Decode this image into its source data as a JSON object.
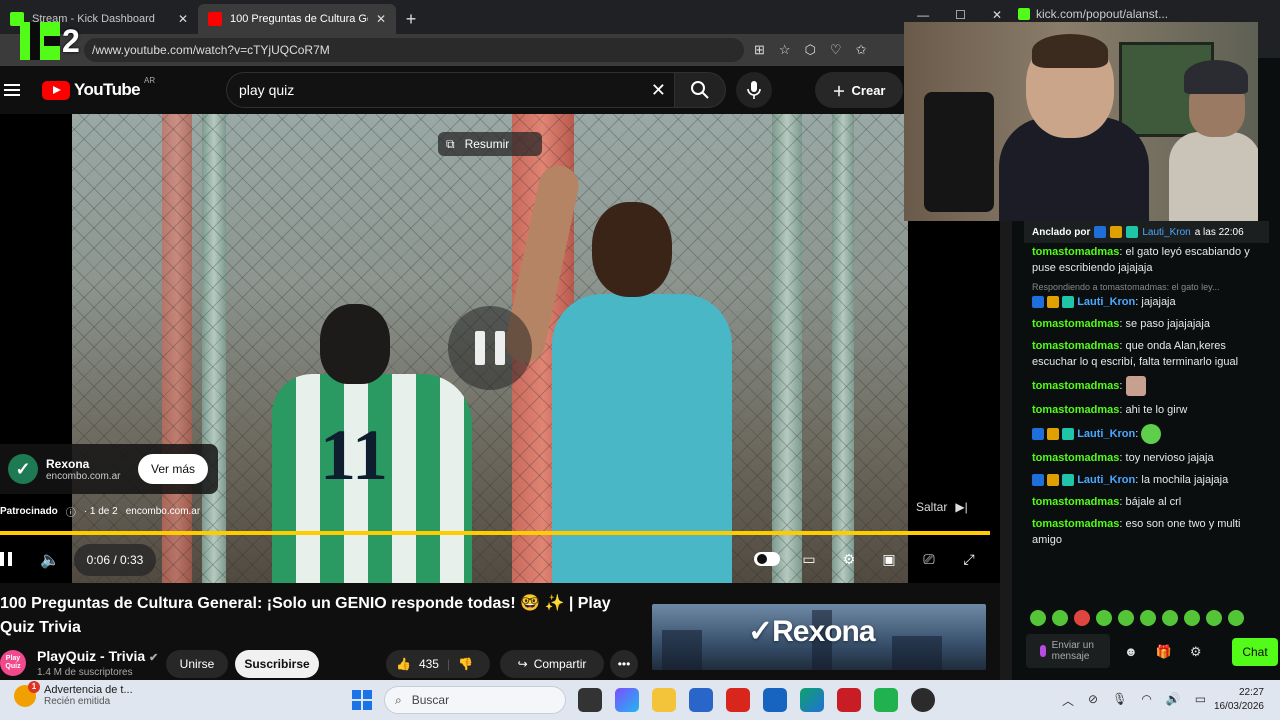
{
  "browser": {
    "tabs": [
      {
        "label": "Stream - Kick Dashboard",
        "active": false,
        "favicon_color": "#53fc18"
      },
      {
        "label": "100 Preguntas de Cultura General",
        "active": true,
        "favicon_color": "#ff0000"
      }
    ],
    "url_visible": "/www.youtube.com/watch?v=cTYjUQCoR7M",
    "new_tab_icon": "plus-icon"
  },
  "overlay": {
    "logo_text": "2"
  },
  "youtube": {
    "country": "AR",
    "logo_text": "YouTube",
    "search_value": "play quiz",
    "create_label": "Crear"
  },
  "player": {
    "resumir_label": "Resumir",
    "ad": {
      "brand": "Rexona",
      "domain": "encombo.com.ar",
      "more_label": "Ver más",
      "sponsored_label": "Patrocinado",
      "ad_count": "· 1 de 2",
      "ad_domain": "encombo.com.ar"
    },
    "skip_label": "Saltar",
    "time": "0:06 / 0:33",
    "jersey_number": "11"
  },
  "video": {
    "title": "100 Preguntas de Cultura General: ¡Solo un GENIO responde todas! 🤓 ✨ | Play Quiz Trivia",
    "channel": "PlayQuiz - Trivia",
    "subscribers": "1.4 M de suscriptores",
    "join_label": "Unirse",
    "subscribe_label": "Suscribirse",
    "likes": "435",
    "share_label": "Compartir",
    "channel_avatar_text": "Play Quiz",
    "banner_brand": "Rexona"
  },
  "kick": {
    "url": "kick.com/popout/alanst...",
    "pinned": {
      "prefix": "Anclado por",
      "user": "Lauti_Kron",
      "time": "a las 22:06"
    },
    "messages": [
      {
        "user": "tomastomadmas",
        "type": "u1",
        "text": "el gato leyó escabiando y puse escribiendo jajajaja"
      },
      {
        "reply": "Respondiendo a tomastomadmas: el gato ley..."
      },
      {
        "user": "Lauti_Kron",
        "type": "u2",
        "badges": true,
        "text": "jajajaja"
      },
      {
        "user": "tomastomadmas",
        "type": "u1",
        "text": "se paso jajajajaja"
      },
      {
        "user": "tomastomadmas",
        "type": "u1",
        "text": "que onda Alan,keres escuchar lo q escribí, falta terminarlo igual"
      },
      {
        "user": "tomastomadmas",
        "type": "u1",
        "emote": "face"
      },
      {
        "user": "tomastomadmas",
        "type": "u1",
        "text": "ahi te lo girw"
      },
      {
        "user": "Lauti_Kron",
        "type": "u2",
        "badges": true,
        "emote": "green"
      },
      {
        "user": "tomastomadmas",
        "type": "u1",
        "text": "toy nervioso jajaja"
      },
      {
        "user": "Lauti_Kron",
        "type": "u2",
        "badges": true,
        "text": "la mochila jajajaja"
      },
      {
        "user": "tomastomadmas",
        "type": "u1",
        "text": "bájale al crl"
      },
      {
        "user": "tomastomadmas",
        "type": "u1",
        "text": "eso son one two y multi amigo"
      }
    ],
    "input_placeholder": "Enviar un mensaje",
    "chat_button": "Chat"
  },
  "taskbar": {
    "notification_title": "Advertencia de t...",
    "notification_sub": "Recién emitida",
    "notification_badge": "1",
    "search_label": "Buscar",
    "time": "22:27",
    "date": "16/03/2026"
  }
}
